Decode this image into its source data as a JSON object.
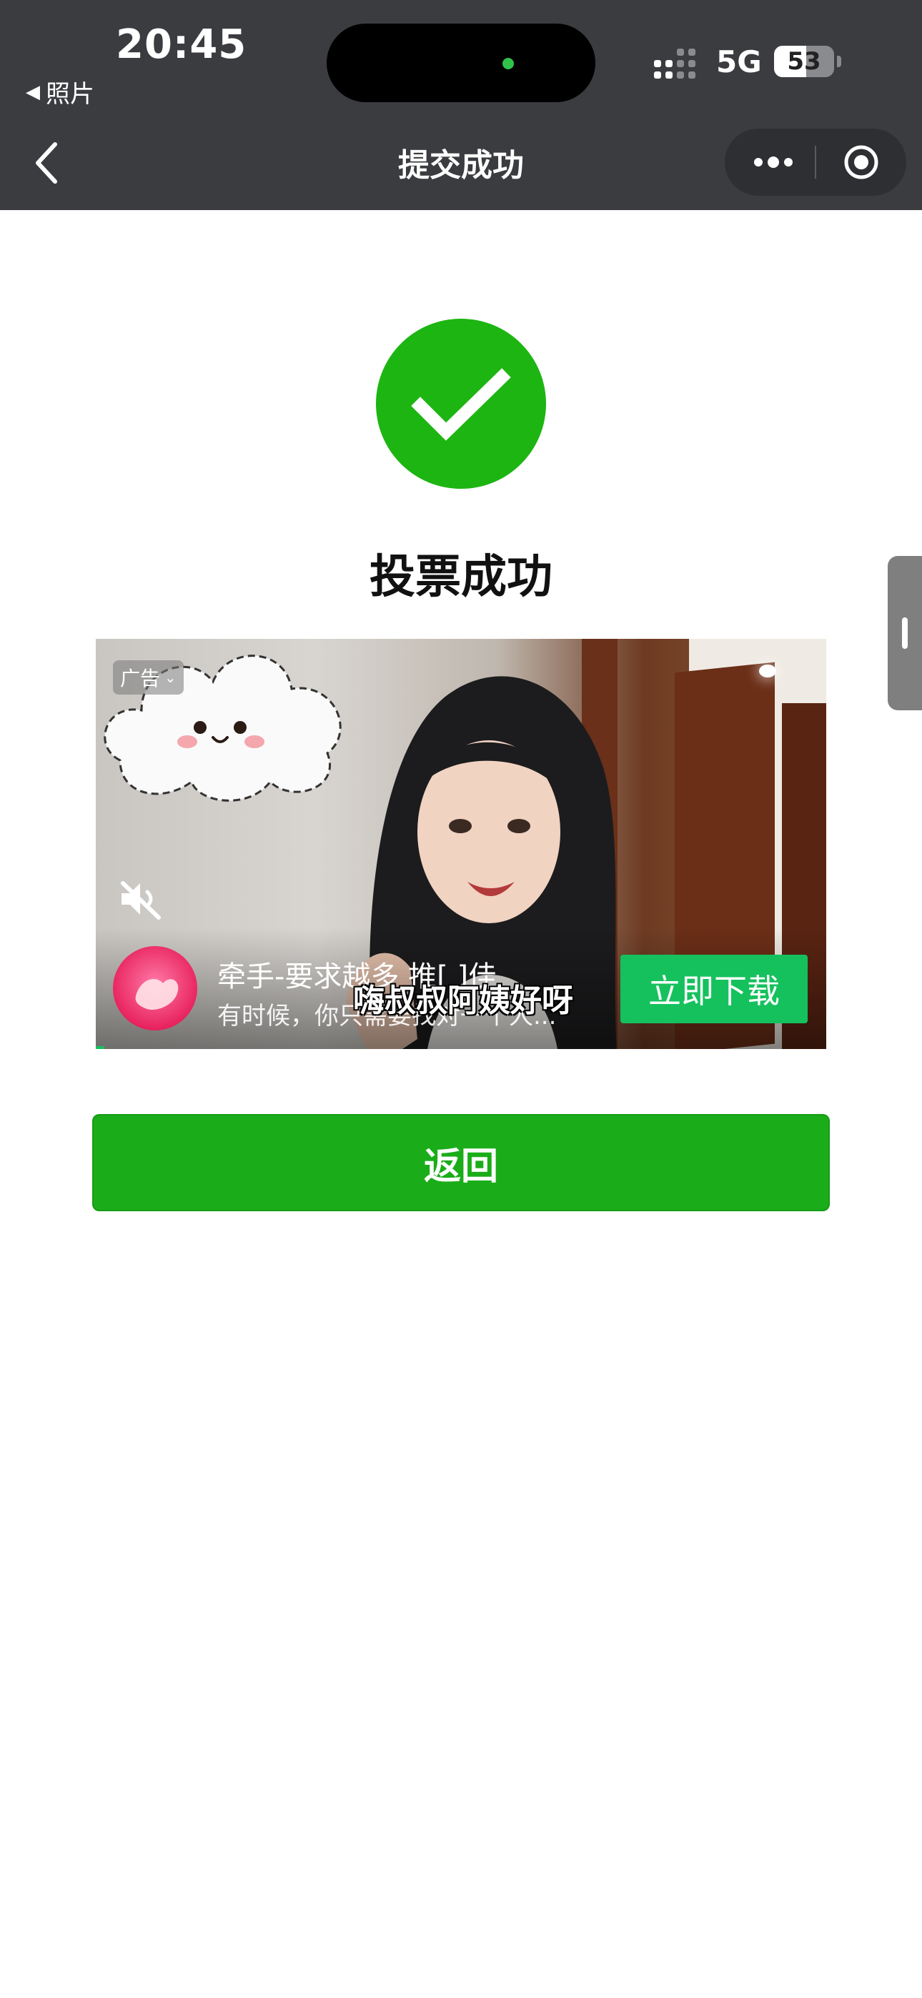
{
  "status_bar": {
    "time": "20:45",
    "back_app_label": "照片",
    "network": "5G",
    "battery_percent": "53",
    "battery_level": 0.53
  },
  "nav": {
    "title": "提交成功",
    "back_icon": "chevron-left-icon",
    "more_icon": "more-dots-icon",
    "close_icon": "target-circle-icon"
  },
  "result": {
    "icon": "check-circle-icon",
    "title": "投票成功",
    "color": "#1db512"
  },
  "ad": {
    "tag": "广告",
    "app_name": "牵手-要求越多 推[   ]佳",
    "app_desc": "有时候，你只需要找对一个人...",
    "subtitle": "嗨叔叔阿姨好呀",
    "cta": "立即下载",
    "cta_color": "#15c15d",
    "mute_icon": "speaker-mute-icon"
  },
  "actions": {
    "return_label": "返回",
    "return_color": "#1aad19"
  }
}
